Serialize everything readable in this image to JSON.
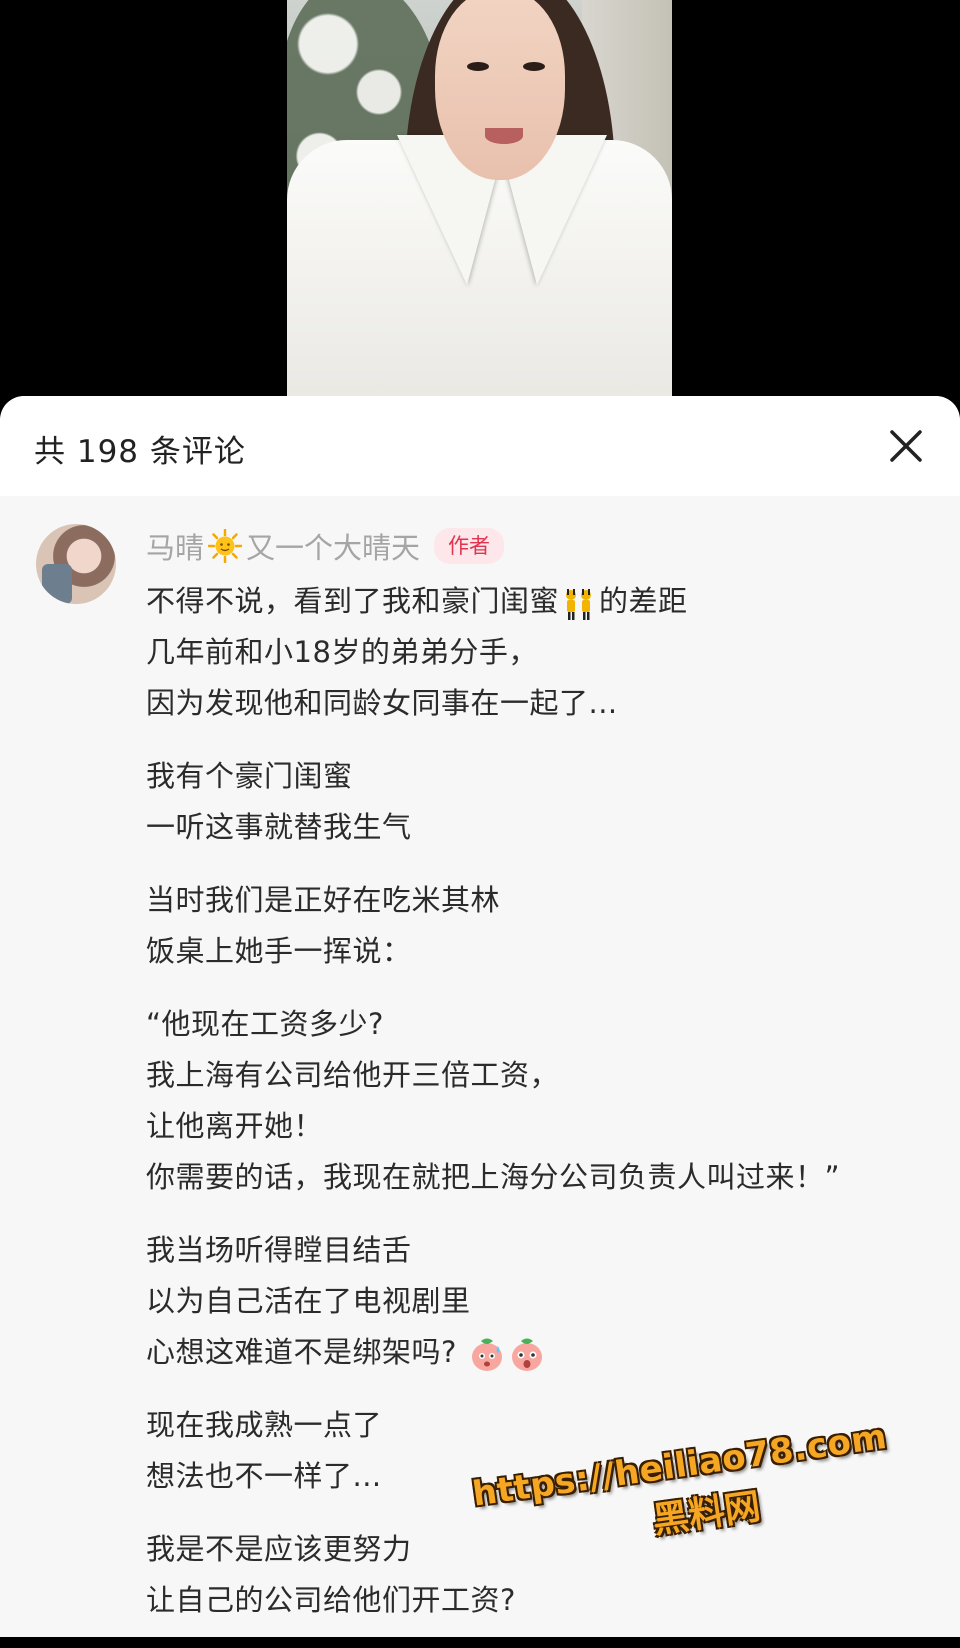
{
  "header": {
    "title": "共 198 条评论"
  },
  "comment": {
    "author_name_part1": "马晴",
    "author_name_part2": "又一个大晴天",
    "author_badge": "作者",
    "paragraphs": [
      [
        "不得不说，看到了我和豪门闺蜜",
        "的差距",
        "几年前和小18岁的弟弟分手，",
        "因为发现他和同龄女同事在一起了..."
      ],
      [
        "我有个豪门闺蜜",
        "一听这事就替我生气"
      ],
      [
        "当时我们是正好在吃米其林",
        "饭桌上她手一挥说："
      ],
      [
        "“他现在工资多少?",
        "我上海有公司给他开三倍工资，",
        "让他离开她！",
        "你需要的话，我现在就把上海分公司负责人叫过来！”"
      ],
      [
        "我当场听得瞠目结舌",
        "以为自己活在了电视剧里",
        "心想这难道不是绑架吗?"
      ],
      [
        "现在我成熟一点了",
        "想法也不一样了..."
      ],
      [
        "我是不是应该更努力",
        "让自己的公司给他们开工资?"
      ]
    ]
  },
  "watermark": {
    "url": "https://heiliao78.com",
    "name": "黑料网"
  },
  "icons": {
    "close": "close-icon",
    "sun": "sun-emoji-icon",
    "twins": "dancing-twins-emoji-icon",
    "peach_sweat": "peach-sweat-emoji-icon",
    "peach_shock": "peach-shock-emoji-icon"
  },
  "colors": {
    "badge_text": "#e0344f",
    "badge_bg": "#fde7ea",
    "author_name": "#a5a5a5",
    "watermark": "#f5a623"
  }
}
